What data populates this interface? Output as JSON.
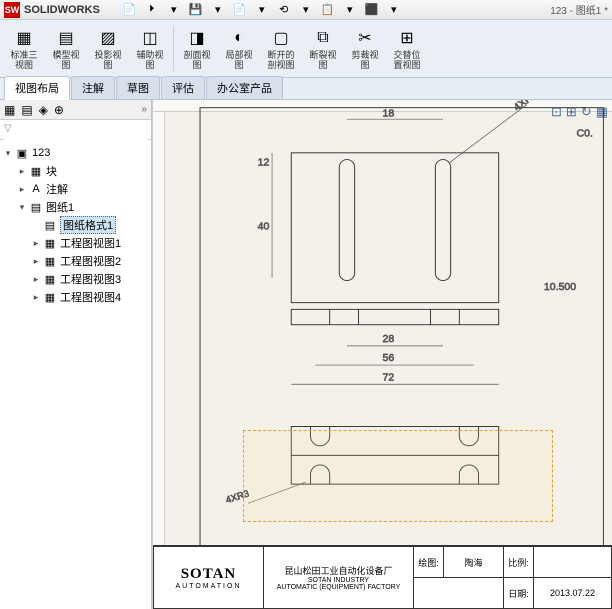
{
  "app": {
    "name": "SOLIDWORKS",
    "doctitle": "123 - 图纸1 *"
  },
  "qat": [
    "📄",
    "🞂",
    "▾",
    "💾",
    "▾",
    "📄",
    "▾",
    "⟲",
    "▾",
    "📋",
    "▾",
    "⬛",
    "▾"
  ],
  "ribbon": [
    {
      "icon": "▦",
      "label": "标准三\n视图"
    },
    {
      "icon": "▤",
      "label": "模型视\n图"
    },
    {
      "icon": "▨",
      "label": "投影视\n图"
    },
    {
      "icon": "◫",
      "label": "辅助视\n图"
    },
    {
      "sep": true
    },
    {
      "icon": "◨",
      "label": "剖面视\n图"
    },
    {
      "icon": "◐",
      "label": "局部视\n图"
    },
    {
      "icon": "▢",
      "label": "断开的\n剖视图"
    },
    {
      "icon": "⧉",
      "label": "断裂视\n图"
    },
    {
      "icon": "✂",
      "label": "剪裁视\n图"
    },
    {
      "icon": "⊞",
      "label": "交替位\n置视图"
    }
  ],
  "tabs": [
    {
      "label": "视图布局",
      "active": true
    },
    {
      "label": "注解"
    },
    {
      "label": "草图"
    },
    {
      "label": "评估"
    },
    {
      "label": "办公室产品"
    }
  ],
  "search": {
    "placeholder": ""
  },
  "tree": {
    "root": {
      "label": "123",
      "icon": "▣"
    },
    "blocks": {
      "label": "块",
      "icon": "▦"
    },
    "annot": {
      "label": "注解",
      "icon": "A"
    },
    "sheet": {
      "label": "图纸1",
      "icon": "▤"
    },
    "items": [
      {
        "label": "图纸格式1",
        "icon": "▤",
        "sel": true
      },
      {
        "label": "工程图视图1",
        "icon": "▦"
      },
      {
        "label": "工程图视图2",
        "icon": "▦"
      },
      {
        "label": "工程图视图3",
        "icon": "▦"
      },
      {
        "label": "工程图视图4",
        "icon": "▦"
      }
    ]
  },
  "dims": {
    "d18": "18",
    "d12": "12",
    "d40": "40",
    "d28": "28",
    "d56": "56",
    "d72": "72",
    "d10_5": "10.500",
    "r4x3": "4XR3",
    "c0": "C0."
  },
  "titleblock": {
    "logo": "SOTAN",
    "logosub": "AUTOMATION",
    "company_cn": "昆山松田工业自动化设备厂",
    "company_en1": "SOTAN INDUSTRY",
    "company_en2": "AUTOMATIC (EQUIPMENT) FACTORY",
    "draw_label": "绘图:",
    "draw_name": "陶海",
    "scale_label": "比例:",
    "date_label": "日期:",
    "date_value": "2013.07.22"
  }
}
